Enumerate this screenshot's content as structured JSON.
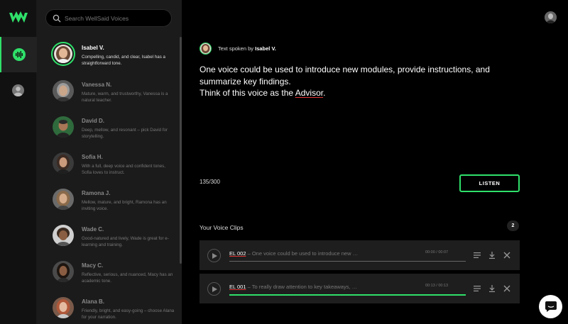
{
  "colors": {
    "accent": "#2fe06a",
    "background": "#000000",
    "sidebar": "#1b1b1b",
    "clip_bg": "#1e1e1e"
  },
  "search": {
    "placeholder": "Search WellSaid Voices"
  },
  "voices": [
    {
      "name": "Isabel V.",
      "description": "Compelling, candid, and clear, Isabel has a straightforward tone.",
      "selected": true
    },
    {
      "name": "Vanessa N.",
      "description": "Mature, warm, and trustworthy, Vanessa is a natural teacher."
    },
    {
      "name": "David D.",
      "description": "Deep, mellow, and resonant – pick David for storytelling."
    },
    {
      "name": "Sofia H.",
      "description": "With a full, deep voice and confident tones, Sofia loves to instruct."
    },
    {
      "name": "Ramona J.",
      "description": "Mellow, mature, and bright, Ramona has an inviting voice."
    },
    {
      "name": "Wade C.",
      "description": "Good-natured and lively, Wade is great for e-learning and training."
    },
    {
      "name": "Macy C.",
      "description": "Reflective, serious, and nuanced, Macy has an academic tone."
    },
    {
      "name": "Alana B.",
      "description": "Friendly, bright, and easy-going – choose Alana for your narration."
    }
  ],
  "editor": {
    "spoken_prefix": "Text spoken by ",
    "speaker": "Isabel V.",
    "script_line1": "One voice could be used to introduce new modules, provide instructions, and summarize key findings.",
    "script_line2_prefix": "Think of this voice as the ",
    "script_line2_link": "Advisor",
    "script_line2_suffix": ".",
    "char_count": "135/300",
    "listen_label": "LISTEN"
  },
  "clips": {
    "title": "Your Voice Clips",
    "count": "2",
    "items": [
      {
        "id": "EL 002",
        "text": " – One voice could be used to introduce new …",
        "time": "00:00 / 00:07",
        "progress": 0
      },
      {
        "id": "EL 001",
        "text": " – To really draw attention to key takeaways, …",
        "time": "00:13 / 00:13",
        "progress": 1
      }
    ]
  },
  "icons": {
    "logo": "wellsaid-logo-icon",
    "voices_nav": "voice-wave-icon",
    "user_nav": "user-avatar-icon",
    "search": "search-icon",
    "play": "play-icon",
    "details": "list-icon",
    "download": "download-icon",
    "delete": "close-icon",
    "chat": "chat-icon"
  }
}
